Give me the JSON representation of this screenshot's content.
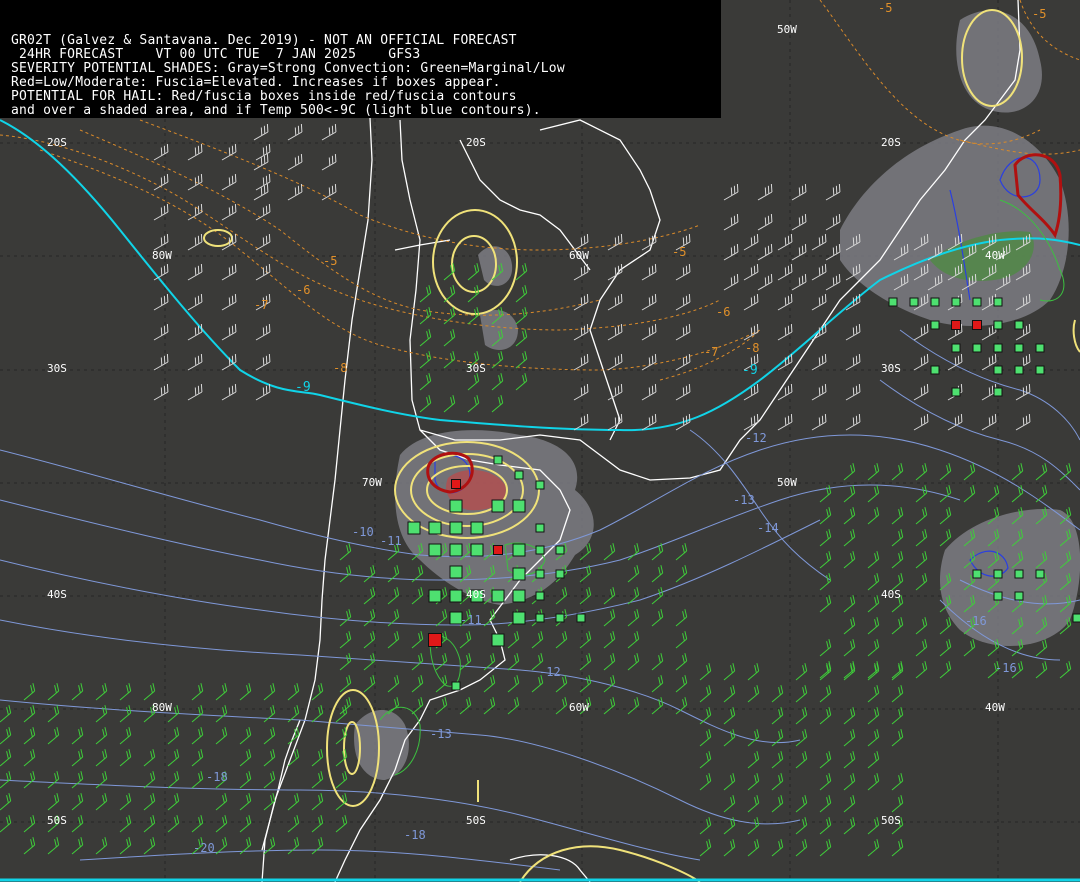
{
  "header": {
    "line1": "GR02T (Galvez & Santavana. Dec 2019) - NOT AN OFFICIAL FORECAST",
    "line2": " 24HR FORECAST    VT 00 UTC TUE  7 JAN 2025    GFS3",
    "line3": "SEVERITY POTENTIAL SHADES: Gray=Strong Convection: Green=Marginal/Low",
    "line4": "Red=Low/Moderate: Fuscia=Elevated. Increases if boxes appear.",
    "line5": "POTENTIAL FOR HAIL: Red/fuscia boxes inside red/fuscia contours",
    "line6": "and over a shaded area, and if Temp 500<-9C (light blue contours)."
  },
  "grid_labels": {
    "lat_20s_west": "20S",
    "lat_20s_center": "20S",
    "lat_20s_east": "20S",
    "lat_30s_west": "30S",
    "lat_30s_center": "30S",
    "lat_30s_east": "30S",
    "lat_40s_west": "40S",
    "lat_40s_center": "40S",
    "lat_40s_east": "40S",
    "lat_50s_west": "50S",
    "lat_50s_center": "50S",
    "lat_50s_east": "50S",
    "lon_80w_top": "80W",
    "lon_60w_top": "60W",
    "lon_40w_top": "40W",
    "lon_50w_top": "50W",
    "lon_70w_mid": "70W",
    "lon_50w_mid": "50W",
    "lon_80w_bottom": "80W",
    "lon_60w_bottom": "60W",
    "lon_40w_bottom": "40W"
  },
  "contour_labels": {
    "orange_m5_a": "-5",
    "orange_m6": "-6",
    "orange_m7_a": "-7",
    "orange_m5_b": "-5",
    "orange_m6_b": "-6",
    "orange_m7_b": "-7",
    "orange_m8_a": "-8",
    "orange_m8_b": "-8",
    "orange_m5_top": "-5",
    "orange_m5_top2": "-5",
    "cyan_m9_a": "-9",
    "cyan_m9_b": "-9",
    "blue_m10": "-10",
    "blue_m11": "-11",
    "blue_m12_a": "-12",
    "blue_m13_a": "-13",
    "blue_m14": "-14",
    "blue_m11_b": "-11",
    "blue_m12_b": "-12",
    "blue_m13_b": "-13",
    "blue_m18_a": "-18",
    "blue_m18_b": "-18",
    "blue_m20": "-20",
    "blue_m16_a": "-16",
    "blue_m16_b": "-16"
  },
  "legend_colors": {
    "background": "#3a3a38",
    "strong_convection_gray": "#8a8a90",
    "marginal_green": "#4ea84a",
    "low_moderate_red": "#d03030",
    "temp500_contour_lightblue": "#10d4e8",
    "coastline": "#ffffff",
    "yellow_contour": "#f0e27a",
    "orange_contour": "#d98a2a",
    "box_green": "#4ee070",
    "box_red": "#e01818"
  }
}
